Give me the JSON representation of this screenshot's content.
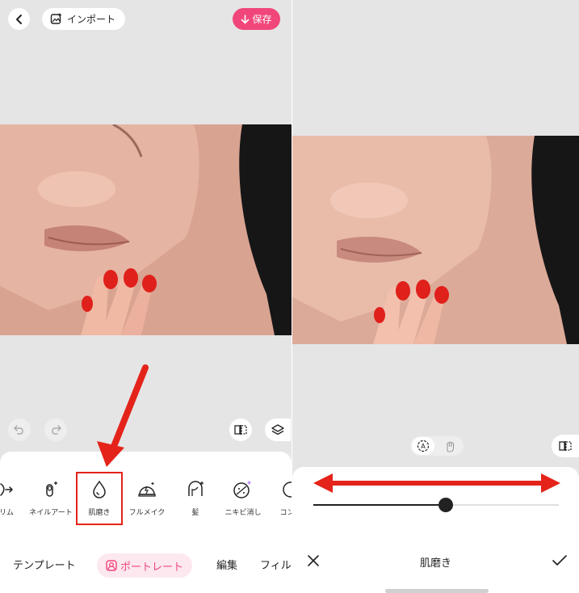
{
  "left": {
    "header": {
      "import_label": "インポート",
      "save_label": "保存"
    },
    "tools": [
      {
        "label": "リム",
        "icon": "slim-icon"
      },
      {
        "label": "ネイルアート",
        "icon": "nail-art-icon"
      },
      {
        "label": "肌磨き",
        "icon": "skin-smoothing-icon"
      },
      {
        "label": "フルメイク",
        "icon": "full-makeup-icon"
      },
      {
        "label": "髪",
        "icon": "hair-icon"
      },
      {
        "label": "ニキビ消し",
        "icon": "acne-removal-icon"
      },
      {
        "label": "コンシ",
        "icon": "concealer-icon"
      }
    ],
    "tabs": {
      "template": "テンプレート",
      "portrait": "ポートレート",
      "edit": "編集",
      "filter": "フィル"
    }
  },
  "right": {
    "title": "肌磨き",
    "slider": {
      "value": 0.54
    }
  },
  "colors": {
    "accent": "#f1467a",
    "annotation_red": "#e4231a"
  }
}
